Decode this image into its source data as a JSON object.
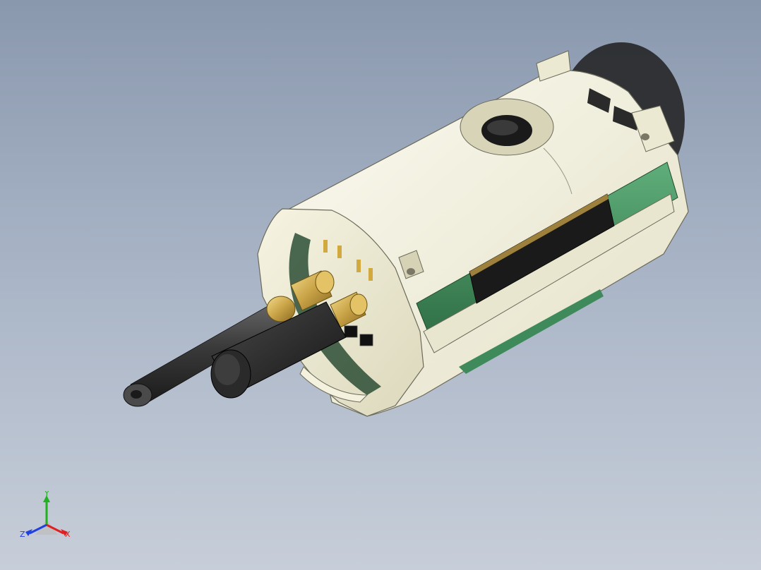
{
  "viewport": {
    "background_top": "#8a98ae",
    "background_bottom": "#c7ced9"
  },
  "model": {
    "icon": "cad-assembly-model",
    "body_color": "#f1efd8",
    "pcb_color": "#3f8a5a",
    "connector_color": "#1a1a1a",
    "brass_color": "#c9a347"
  },
  "triad": {
    "x_label": "X",
    "y_label": "Y",
    "z_label": "Z",
    "x_color": "#e02020",
    "y_color": "#20b020",
    "z_color": "#2040e0"
  }
}
